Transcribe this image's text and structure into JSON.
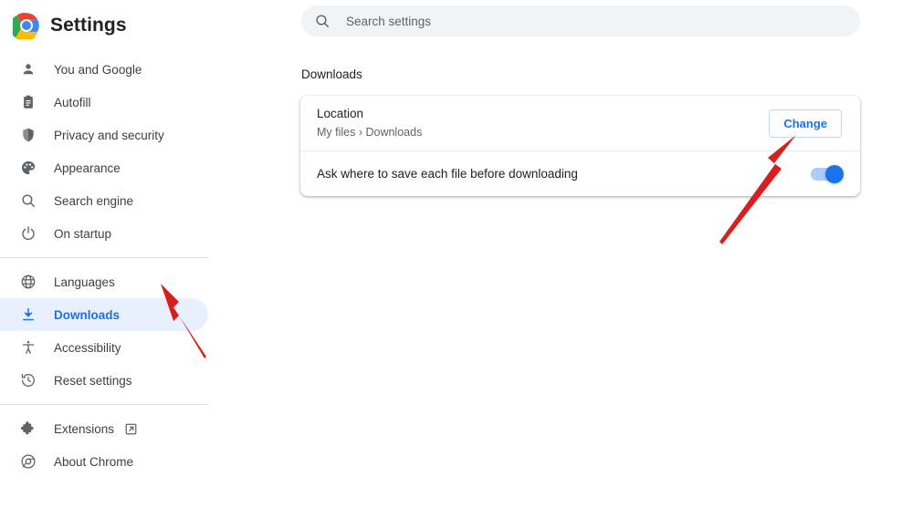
{
  "brand": {
    "title": "Settings",
    "logo_icon": "chrome-logo-icon"
  },
  "sidebar": {
    "groups": [
      {
        "items": [
          {
            "label": "You and Google",
            "icon": "person-icon",
            "selected": false
          },
          {
            "label": "Autofill",
            "icon": "clipboard-icon",
            "selected": false
          },
          {
            "label": "Privacy and security",
            "icon": "shield-icon",
            "selected": false
          },
          {
            "label": "Appearance",
            "icon": "palette-icon",
            "selected": false
          },
          {
            "label": "Search engine",
            "icon": "search-icon",
            "selected": false
          },
          {
            "label": "On startup",
            "icon": "power-icon",
            "selected": false
          }
        ]
      },
      {
        "items": [
          {
            "label": "Languages",
            "icon": "globe-icon",
            "selected": false
          },
          {
            "label": "Downloads",
            "icon": "download-icon",
            "selected": true
          },
          {
            "label": "Accessibility",
            "icon": "accessibility-icon",
            "selected": false
          },
          {
            "label": "Reset settings",
            "icon": "history-icon",
            "selected": false
          }
        ]
      },
      {
        "items": [
          {
            "label": "Extensions",
            "icon": "puzzle-icon",
            "selected": false,
            "external": true,
            "external_icon": "external-link-icon"
          },
          {
            "label": "About Chrome",
            "icon": "chrome-outline-icon",
            "selected": false,
            "external": false
          }
        ]
      }
    ]
  },
  "search": {
    "placeholder": "Search settings",
    "value": "",
    "icon": "search-icon"
  },
  "main": {
    "section_title": "Downloads",
    "rows": {
      "location": {
        "label": "Location",
        "value": "My files › Downloads",
        "button_label": "Change"
      },
      "ask": {
        "label": "Ask where to save each file before downloading",
        "toggle_state": "on"
      }
    }
  },
  "annotations": {
    "arrow_color": "#d81f20",
    "arrows": [
      {
        "name": "arrow-to-downloads",
        "points_to": "Downloads"
      },
      {
        "name": "arrow-to-change-button",
        "points_to": "Change"
      }
    ]
  },
  "colors": {
    "accent": "#1a73e8",
    "selected_bg": "#e8f0fe",
    "text_primary": "#202124",
    "text_secondary": "#5f6368",
    "search_bg": "#f1f3f4",
    "divider": "#dadce0"
  }
}
